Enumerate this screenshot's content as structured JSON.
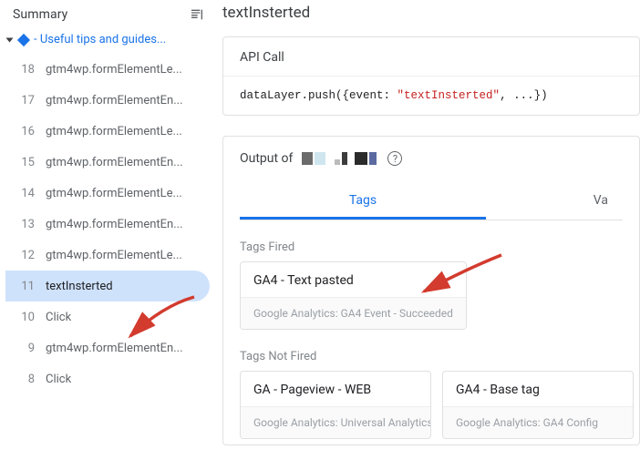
{
  "sidebar": {
    "summary_label": "Summary",
    "group_label": "- Useful tips and guides...",
    "items": [
      {
        "idx": "18",
        "label": "gtm4wp.formElementLe..."
      },
      {
        "idx": "17",
        "label": "gtm4wp.formElementEn..."
      },
      {
        "idx": "16",
        "label": "gtm4wp.formElementLe..."
      },
      {
        "idx": "15",
        "label": "gtm4wp.formElementEn..."
      },
      {
        "idx": "14",
        "label": "gtm4wp.formElementLe..."
      },
      {
        "idx": "13",
        "label": "gtm4wp.formElementEn..."
      },
      {
        "idx": "12",
        "label": "gtm4wp.formElementLe..."
      },
      {
        "idx": "11",
        "label": "textInsterted"
      },
      {
        "idx": "10",
        "label": "Click"
      },
      {
        "idx": "9",
        "label": "gtm4wp.formElementEn..."
      },
      {
        "idx": "8",
        "label": "Click"
      }
    ],
    "selected_idx": "11"
  },
  "page_title": "textInsterted",
  "api_card": {
    "header": "API Call",
    "code_prefix": "dataLayer.push({event: ",
    "code_value": "\"textInsterted\"",
    "code_suffix": ", ...})"
  },
  "output": {
    "label": "Output of",
    "help_char": "?",
    "tabs": [
      {
        "label": "Tags"
      },
      {
        "label": "Va"
      }
    ],
    "fired_label": "Tags Fired",
    "fired": [
      {
        "name": "GA4 - Text pasted",
        "meta": "Google Analytics: GA4 Event - Succeeded"
      }
    ],
    "not_fired_label": "Tags Not Fired",
    "not_fired": [
      {
        "name": "GA - Pageview - WEB",
        "meta": "Google Analytics: Universal Analytics"
      },
      {
        "name": "GA4 - Base tag",
        "meta": "Google Analytics: GA4 Config"
      }
    ]
  },
  "colors": {
    "accent": "#1a73e8",
    "arrow": "#d23b2e"
  }
}
